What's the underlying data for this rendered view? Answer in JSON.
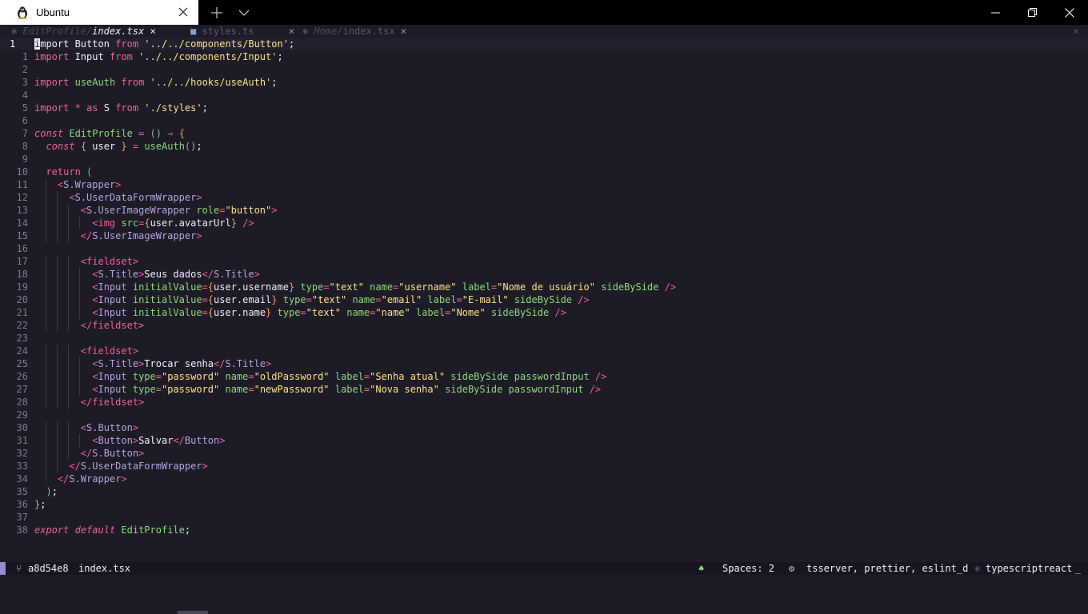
{
  "window": {
    "tab_title": "Ubuntu",
    "icons": {
      "app": "tux-penguin-icon",
      "tab_close": "close-icon",
      "new_tab": "plus-icon",
      "dropdown": "chevron-down-icon",
      "minimize": "minimize-icon",
      "maximize": "maximize-icon",
      "close": "close-icon"
    }
  },
  "tabs": [
    {
      "dir": "EditProfile/",
      "file": "index.tsx",
      "close": "×",
      "active": true,
      "icon": "react-icon"
    },
    {
      "dir": "",
      "file": "styles.ts",
      "close": "×",
      "active": false,
      "icon": "typescript-icon"
    },
    {
      "dir": "Home/",
      "file": "index.tsx",
      "close": "×",
      "active": false,
      "icon": "react-icon"
    }
  ],
  "tabline_close": "×",
  "editor": {
    "current_line_number": "1",
    "relative_numbers": [
      "1",
      "1",
      "2",
      "3",
      "4",
      "5",
      "6",
      "7",
      "8",
      "9",
      "10",
      "11",
      "12",
      "13",
      "14",
      "15",
      "16",
      "17",
      "18",
      "19",
      "20",
      "21",
      "22",
      "23",
      "24",
      "25",
      "26",
      "27",
      "28",
      "29",
      "30",
      "31",
      "32",
      "33",
      "34",
      "35",
      "36",
      "37",
      "38"
    ],
    "lines": [
      "import Button from '../../components/Button';",
      "import Input from '../../components/Input';",
      "",
      "import useAuth from '../../hooks/useAuth';",
      "",
      "import * as S from './styles';",
      "",
      "const EditProfile = () ⇒ {",
      "  const { user } = useAuth();",
      "",
      "  return (",
      "    <S.Wrapper>",
      "      <S.UserDataFormWrapper>",
      "        <S.UserImageWrapper role=\"button\">",
      "          <img src={user.avatarUrl} />",
      "        </S.UserImageWrapper>",
      "",
      "        <fieldset>",
      "          <S.Title>Seus dados</S.Title>",
      "          <Input initialValue={user.username} type=\"text\" name=\"username\" label=\"Nome de usuário\" sideBySide />",
      "          <Input initialValue={user.email} type=\"text\" name=\"email\" label=\"E-mail\" sideBySide />",
      "          <Input initialValue={user.name} type=\"text\" name=\"name\" label=\"Nome\" sideBySide />",
      "        </fieldset>",
      "",
      "        <fieldset>",
      "          <S.Title>Trocar senha</S.Title>",
      "          <Input type=\"password\" name=\"oldPassword\" label=\"Senha atual\" sideBySide passwordInput />",
      "          <Input type=\"password\" name=\"newPassword\" label=\"Nova senha\" sideBySide passwordInput />",
      "        </fieldset>",
      "",
      "        <S.Button>",
      "          <Button>Salvar</Button>",
      "        </S.Button>",
      "      </S.UserDataFormWrapper>",
      "    </S.Wrapper>",
      "  );",
      "};",
      "",
      "export default EditProfile;"
    ]
  },
  "statusline": {
    "branch_icon": "git-branch-icon",
    "commit": "a8d54e8",
    "filename": "index.tsx",
    "bell_icon": "bell-icon",
    "spaces": "Spaces: 2",
    "lsp_icon": "gear-icon",
    "lsp": "tsserver, prettier, eslint_d",
    "ft_icon": "react-icon",
    "filetype": "typescriptreact"
  }
}
